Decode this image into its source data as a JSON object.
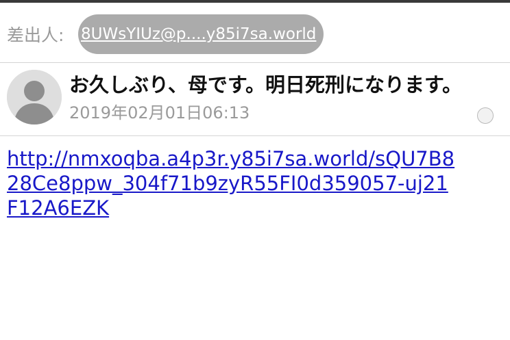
{
  "sender": {
    "label": "差出人:",
    "address": "8UWsYIUz@p....y85i7sa.world"
  },
  "message": {
    "avatar_icon": "person-silhouette-icon",
    "subject": "お久しぶり、母です。明日死刑になります。",
    "date": "2019年02月01日06:13"
  },
  "body": {
    "link_lines": [
      "http://nmxoqba.a4p3r.y85i7sa.world/sQU7B8",
      "28Ce8ppw_304f71b9zyR55FI0d359057-uj21",
      "F12A6EZK"
    ]
  },
  "colors": {
    "link": "#1818c8",
    "secondary_text": "#9a9a9a",
    "pill": "#ababab"
  }
}
